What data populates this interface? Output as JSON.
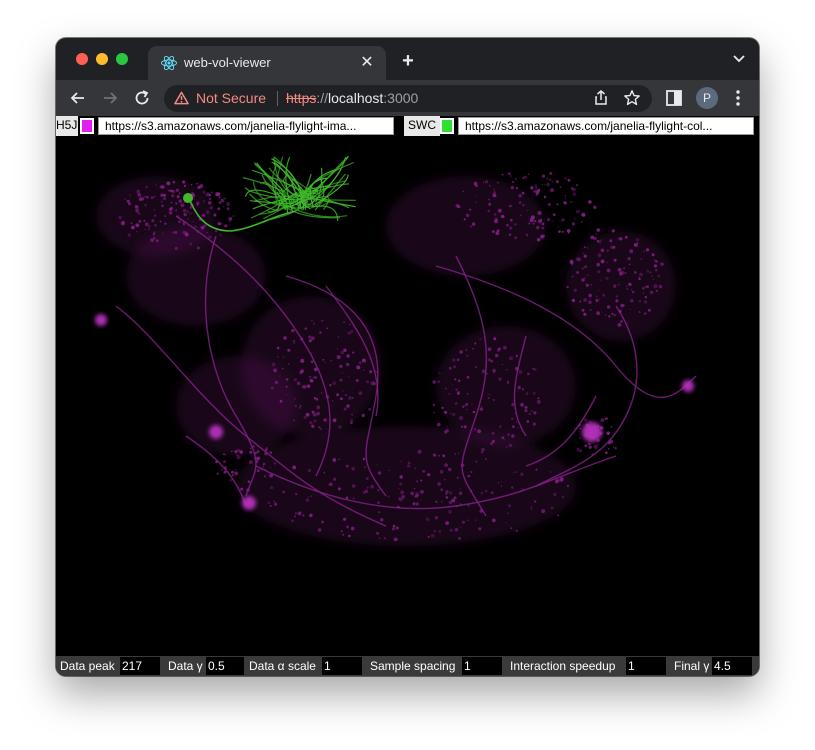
{
  "browser": {
    "tab_title": "web-vol-viewer",
    "tab_close": "✕",
    "new_tab": "+",
    "security_label": "Not Secure",
    "url_scheme": "https",
    "url_sep": "://",
    "url_host": "localhost",
    "url_port": ":3000",
    "profile_initial": "P"
  },
  "controls": {
    "h5j_label": "H5J",
    "h5j_color": "#e020f0",
    "h5j_url": "https://s3.amazonaws.com/janelia-flylight-ima...",
    "swc_label": "SWC",
    "swc_color": "#30e030",
    "swc_url": "https://s3.amazonaws.com/janelia-flylight-col..."
  },
  "params": {
    "data_peak_label": "Data peak",
    "data_peak_value": "217",
    "data_gamma_label": "Data γ",
    "data_gamma_value": "0.5",
    "data_alpha_label": "Data α scale",
    "data_alpha_value": "1",
    "sample_spacing_label": "Sample spacing",
    "sample_spacing_value": "1",
    "interaction_speedup_label": "Interaction speedup",
    "interaction_speedup_value": "1",
    "final_gamma_label": "Final γ",
    "final_gamma_value": "4.5"
  },
  "colors": {
    "volume": "#8a1f8c",
    "neuron": "#3fb82a"
  }
}
